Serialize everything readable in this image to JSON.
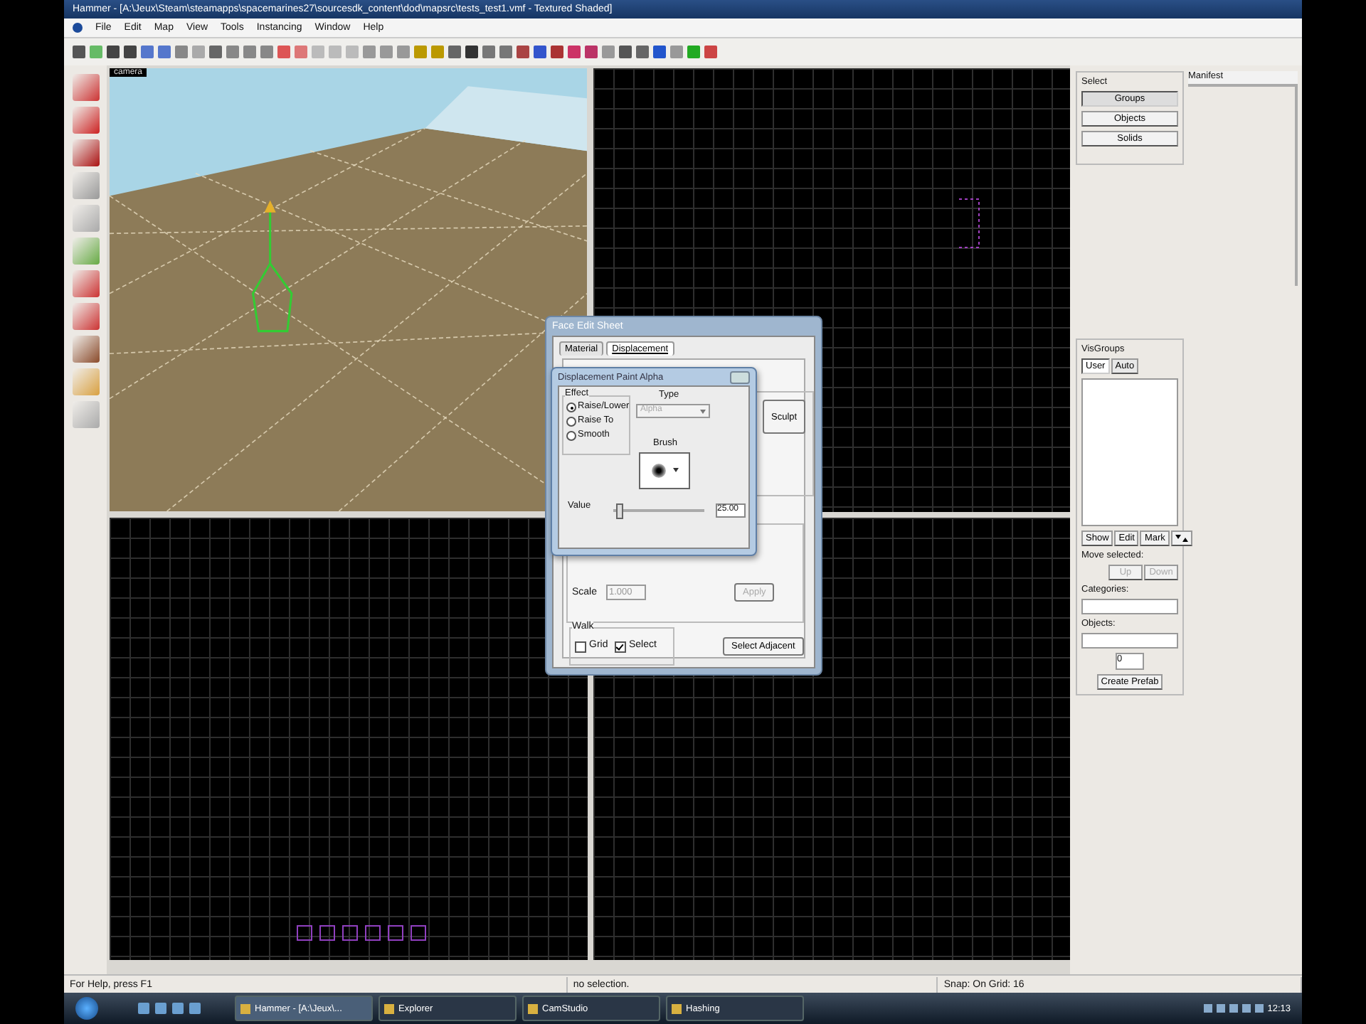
{
  "window": {
    "title": "Hammer - [A:\\Jeux\\Steam\\steamapps\\spacemarines27\\sourcesdk_content\\dod\\mapsrc\\tests_test1.vmf - Textured Shaded]"
  },
  "menu": [
    "File",
    "Edit",
    "Map",
    "View",
    "Tools",
    "Instancing",
    "Window",
    "Help"
  ],
  "viewports": [
    {
      "kind": "perspective",
      "label": "camera"
    },
    {
      "kind": "grid"
    },
    {
      "kind": "grid"
    },
    {
      "kind": "grid"
    }
  ],
  "face_edit": {
    "title": "Face Edit Sheet",
    "tabs": [
      {
        "label": "Material",
        "selected": false
      },
      {
        "label": "Displacement",
        "selected": true
      }
    ],
    "sculpt_button": "Sculpt",
    "scale_label": "Scale",
    "scale_value": "1.000",
    "apply_button": "Apply",
    "walk_label": "Walk",
    "walk_options": [
      {
        "label": "Grid",
        "checked": false
      },
      {
        "label": "Select",
        "checked": true
      }
    ],
    "select_adjacent_button": "Select Adjacent"
  },
  "paint_alpha": {
    "title": "Displacement Paint Alpha",
    "effect_label": "Effect",
    "effect_options": [
      {
        "label": "Raise/Lower",
        "selected": true
      },
      {
        "label": "Raise To",
        "selected": false
      },
      {
        "label": "Smooth",
        "selected": false
      }
    ],
    "type_label": "Type",
    "type_value": "Alpha",
    "brush_label": "Brush",
    "value_label": "Value",
    "slider": {
      "level": 0.06
    },
    "value": "25.00"
  },
  "right_panel": {
    "select_label": "Select",
    "select_buttons": [
      {
        "label": "Groups",
        "selected": true
      },
      {
        "label": "Objects",
        "selected": false
      },
      {
        "label": "Solids",
        "selected": false
      }
    ],
    "manifest_label": "Manifest",
    "visgroups_label": "VisGroups",
    "visgroup_tabs": [
      {
        "label": "User",
        "selected": true
      },
      {
        "label": "Auto",
        "selected": false
      }
    ],
    "visgroup_buttons": [
      "Show",
      "Edit",
      "Mark"
    ],
    "move_selected_label": "Move selected:",
    "move_buttons": [
      "Up",
      "Down"
    ],
    "categories_label": "Categories:",
    "objects_label": "Objects:",
    "count_value": "0",
    "create_prefab_button": "Create Prefab"
  },
  "status_bar": [
    "For Help, press F1",
    "no selection.",
    "Snap: On Grid: 16"
  ],
  "taskbar": {
    "items": [
      {
        "label": "Hammer - [A:\\Jeux\\...",
        "selected": true
      },
      {
        "label": "Explorer",
        "selected": false
      },
      {
        "label": "CamStudio",
        "selected": false
      },
      {
        "label": "Hashing",
        "selected": false
      }
    ],
    "clock": "12:13"
  }
}
